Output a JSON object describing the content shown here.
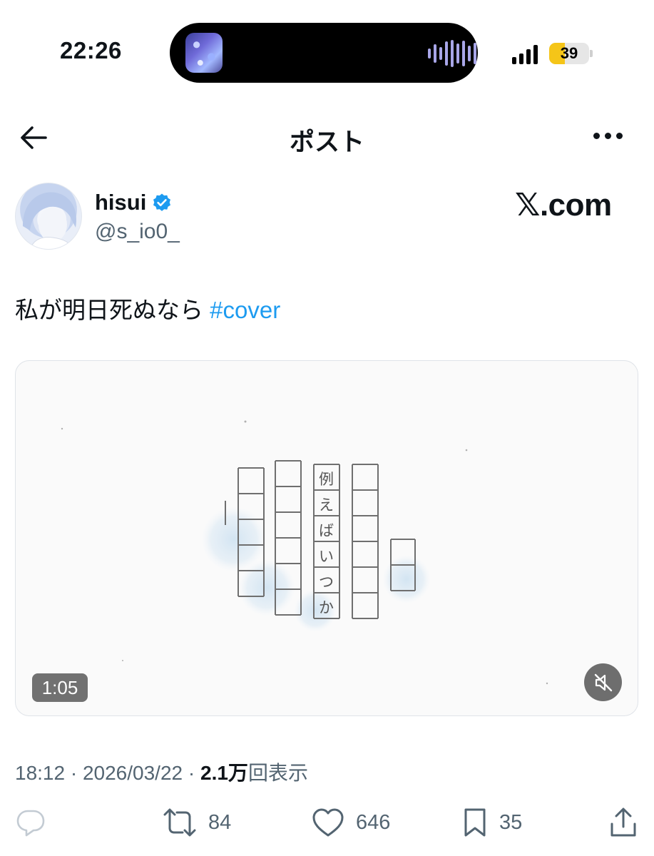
{
  "status_bar": {
    "time": "22:26",
    "battery_level": "39",
    "battery_fraction": 0.39,
    "battery_color": "#f5c518"
  },
  "header": {
    "title": "ポスト"
  },
  "author": {
    "display_name": "hisui",
    "handle": "@s_io0_",
    "verified": true
  },
  "watermark": {
    "site": "𝕏.com"
  },
  "post": {
    "text": "私が明日死ぬなら",
    "hashtag": "#cover",
    "hashtag_color": "#1d9bf0"
  },
  "media": {
    "duration": "1:05",
    "muted": true,
    "vertical_text": [
      "例",
      "え",
      "ば",
      "い",
      "つ",
      "か"
    ]
  },
  "meta": {
    "time": "18:12",
    "separator": "·",
    "date": "2026/03/22",
    "views_count": "2.1万",
    "views_label": "回表示"
  },
  "actions": {
    "reposts": "84",
    "likes": "646",
    "bookmarks": "35"
  }
}
